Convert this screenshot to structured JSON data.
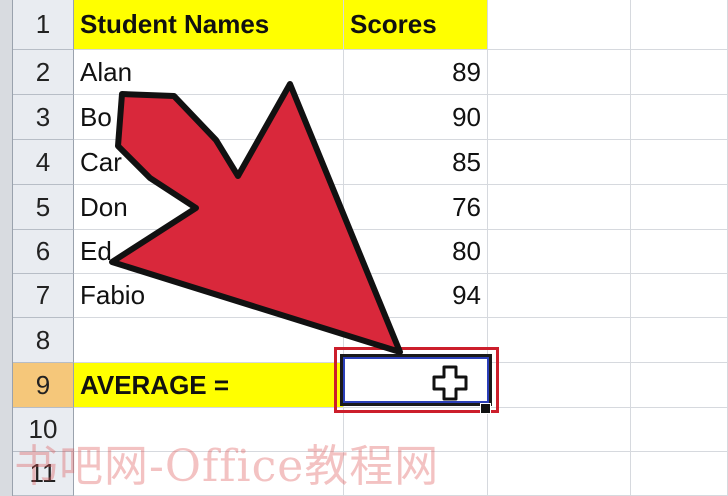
{
  "columns": {
    "a_header": "Student Names",
    "b_header": "Scores"
  },
  "row_numbers": [
    "1",
    "2",
    "3",
    "4",
    "5",
    "6",
    "7",
    "8",
    "9",
    "10",
    "11"
  ],
  "students": [
    {
      "name": "Alan",
      "score": "89"
    },
    {
      "name": "Bo",
      "score": "90"
    },
    {
      "name": "Car",
      "score": "85"
    },
    {
      "name": "Don",
      "score": "76"
    },
    {
      "name": "Ed",
      "score": "80"
    },
    {
      "name": "Fabio",
      "score": "94"
    }
  ],
  "average_label": "AVERAGE =",
  "watermark": "书吧网-Office教程网",
  "colors": {
    "header_fill": "#ffff00",
    "arrow": "#d9283b",
    "selection_outline": "#cc1e2b",
    "active_row": "#f5c77a"
  },
  "icons": {
    "cursor": "plus-cursor-icon",
    "pointer": "red-arrow-icon"
  }
}
